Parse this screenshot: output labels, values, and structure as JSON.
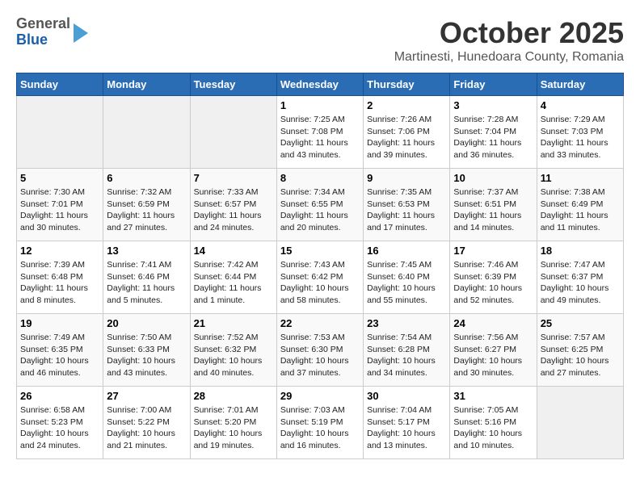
{
  "logo": {
    "general": "General",
    "blue": "Blue"
  },
  "title": "October 2025",
  "subtitle": "Martinesti, Hunedoara County, Romania",
  "days": [
    "Sunday",
    "Monday",
    "Tuesday",
    "Wednesday",
    "Thursday",
    "Friday",
    "Saturday"
  ],
  "weeks": [
    [
      {
        "date": "",
        "info": ""
      },
      {
        "date": "",
        "info": ""
      },
      {
        "date": "",
        "info": ""
      },
      {
        "date": "1",
        "info": "Sunrise: 7:25 AM\nSunset: 7:08 PM\nDaylight: 11 hours and 43 minutes."
      },
      {
        "date": "2",
        "info": "Sunrise: 7:26 AM\nSunset: 7:06 PM\nDaylight: 11 hours and 39 minutes."
      },
      {
        "date": "3",
        "info": "Sunrise: 7:28 AM\nSunset: 7:04 PM\nDaylight: 11 hours and 36 minutes."
      },
      {
        "date": "4",
        "info": "Sunrise: 7:29 AM\nSunset: 7:03 PM\nDaylight: 11 hours and 33 minutes."
      }
    ],
    [
      {
        "date": "5",
        "info": "Sunrise: 7:30 AM\nSunset: 7:01 PM\nDaylight: 11 hours and 30 minutes."
      },
      {
        "date": "6",
        "info": "Sunrise: 7:32 AM\nSunset: 6:59 PM\nDaylight: 11 hours and 27 minutes."
      },
      {
        "date": "7",
        "info": "Sunrise: 7:33 AM\nSunset: 6:57 PM\nDaylight: 11 hours and 24 minutes."
      },
      {
        "date": "8",
        "info": "Sunrise: 7:34 AM\nSunset: 6:55 PM\nDaylight: 11 hours and 20 minutes."
      },
      {
        "date": "9",
        "info": "Sunrise: 7:35 AM\nSunset: 6:53 PM\nDaylight: 11 hours and 17 minutes."
      },
      {
        "date": "10",
        "info": "Sunrise: 7:37 AM\nSunset: 6:51 PM\nDaylight: 11 hours and 14 minutes."
      },
      {
        "date": "11",
        "info": "Sunrise: 7:38 AM\nSunset: 6:49 PM\nDaylight: 11 hours and 11 minutes."
      }
    ],
    [
      {
        "date": "12",
        "info": "Sunrise: 7:39 AM\nSunset: 6:48 PM\nDaylight: 11 hours and 8 minutes."
      },
      {
        "date": "13",
        "info": "Sunrise: 7:41 AM\nSunset: 6:46 PM\nDaylight: 11 hours and 5 minutes."
      },
      {
        "date": "14",
        "info": "Sunrise: 7:42 AM\nSunset: 6:44 PM\nDaylight: 11 hours and 1 minute."
      },
      {
        "date": "15",
        "info": "Sunrise: 7:43 AM\nSunset: 6:42 PM\nDaylight: 10 hours and 58 minutes."
      },
      {
        "date": "16",
        "info": "Sunrise: 7:45 AM\nSunset: 6:40 PM\nDaylight: 10 hours and 55 minutes."
      },
      {
        "date": "17",
        "info": "Sunrise: 7:46 AM\nSunset: 6:39 PM\nDaylight: 10 hours and 52 minutes."
      },
      {
        "date": "18",
        "info": "Sunrise: 7:47 AM\nSunset: 6:37 PM\nDaylight: 10 hours and 49 minutes."
      }
    ],
    [
      {
        "date": "19",
        "info": "Sunrise: 7:49 AM\nSunset: 6:35 PM\nDaylight: 10 hours and 46 minutes."
      },
      {
        "date": "20",
        "info": "Sunrise: 7:50 AM\nSunset: 6:33 PM\nDaylight: 10 hours and 43 minutes."
      },
      {
        "date": "21",
        "info": "Sunrise: 7:52 AM\nSunset: 6:32 PM\nDaylight: 10 hours and 40 minutes."
      },
      {
        "date": "22",
        "info": "Sunrise: 7:53 AM\nSunset: 6:30 PM\nDaylight: 10 hours and 37 minutes."
      },
      {
        "date": "23",
        "info": "Sunrise: 7:54 AM\nSunset: 6:28 PM\nDaylight: 10 hours and 34 minutes."
      },
      {
        "date": "24",
        "info": "Sunrise: 7:56 AM\nSunset: 6:27 PM\nDaylight: 10 hours and 30 minutes."
      },
      {
        "date": "25",
        "info": "Sunrise: 7:57 AM\nSunset: 6:25 PM\nDaylight: 10 hours and 27 minutes."
      }
    ],
    [
      {
        "date": "26",
        "info": "Sunrise: 6:58 AM\nSunset: 5:23 PM\nDaylight: 10 hours and 24 minutes."
      },
      {
        "date": "27",
        "info": "Sunrise: 7:00 AM\nSunset: 5:22 PM\nDaylight: 10 hours and 21 minutes."
      },
      {
        "date": "28",
        "info": "Sunrise: 7:01 AM\nSunset: 5:20 PM\nDaylight: 10 hours and 19 minutes."
      },
      {
        "date": "29",
        "info": "Sunrise: 7:03 AM\nSunset: 5:19 PM\nDaylight: 10 hours and 16 minutes."
      },
      {
        "date": "30",
        "info": "Sunrise: 7:04 AM\nSunset: 5:17 PM\nDaylight: 10 hours and 13 minutes."
      },
      {
        "date": "31",
        "info": "Sunrise: 7:05 AM\nSunset: 5:16 PM\nDaylight: 10 hours and 10 minutes."
      },
      {
        "date": "",
        "info": ""
      }
    ]
  ]
}
